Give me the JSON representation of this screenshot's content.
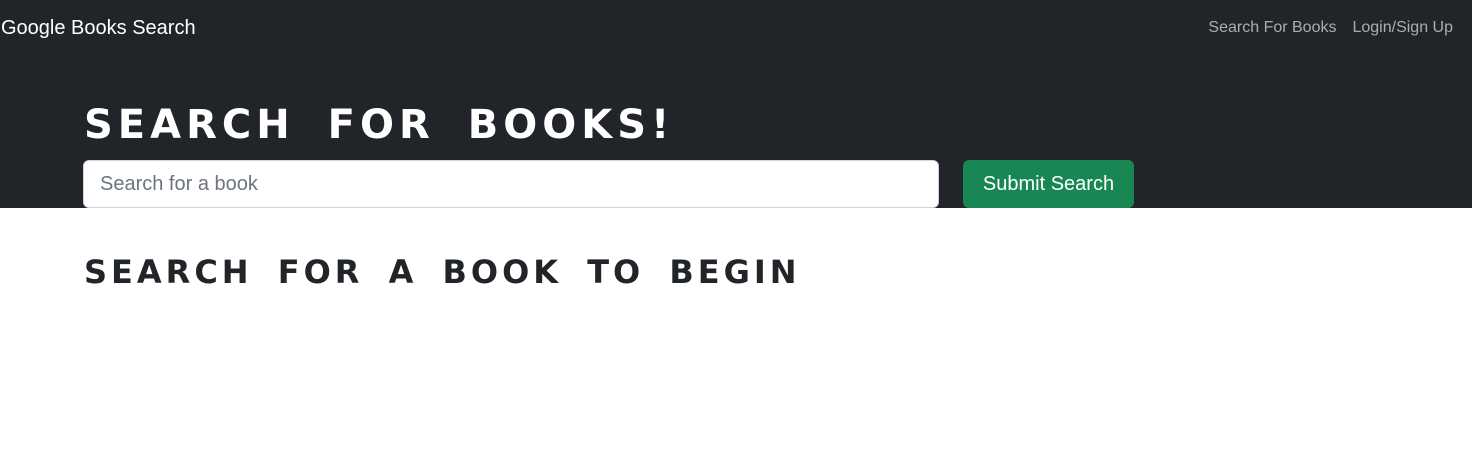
{
  "navbar": {
    "brand": "Google Books Search",
    "links": [
      {
        "label": "Search For Books"
      },
      {
        "label": "Login/Sign Up"
      }
    ],
    "background": "#212529"
  },
  "hero": {
    "title": "SEARCH FOR BOOKS!",
    "search": {
      "placeholder": "Search for a book",
      "value": ""
    },
    "submit_label": "Submit Search",
    "button_color": "#198754"
  },
  "main": {
    "empty_message": "SEARCH FOR A BOOK TO BEGIN"
  }
}
